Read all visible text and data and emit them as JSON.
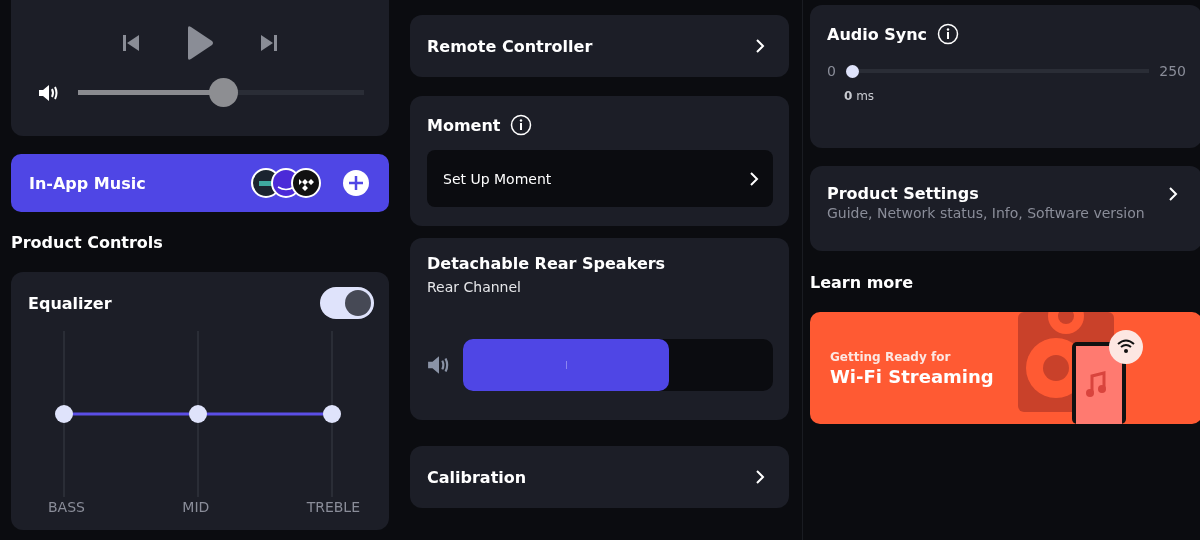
{
  "player": {
    "volume": {
      "level": 0.51
    }
  },
  "in_app_music": {
    "title": "In-App Music"
  },
  "product_controls": {
    "heading": "Product Controls"
  },
  "equalizer": {
    "title": "Equalizer",
    "on": true,
    "bands": [
      {
        "label": "BASS",
        "level": 0.5
      },
      {
        "label": "MID",
        "level": 0.5
      },
      {
        "label": "TREBLE",
        "level": 0.5
      }
    ]
  },
  "remote_controller": {
    "title": "Remote Controller"
  },
  "moment": {
    "title": "Moment",
    "action": "Set Up Moment"
  },
  "rear_speakers": {
    "title": "Detachable Rear Speakers",
    "subtitle": "Rear Channel",
    "level": 0.665
  },
  "calibration": {
    "title": "Calibration"
  },
  "audio_sync": {
    "title": "Audio Sync",
    "min": "0",
    "max": "250",
    "level": 0,
    "reading": "**0** ms"
  },
  "product_settings": {
    "title": "Product Settings",
    "subtitle": "Guide, Network status, Info, Software version"
  },
  "learn_more": {
    "heading": "Learn more",
    "banner": {
      "kicker": "Getting Ready for",
      "title": "Wi-Fi Streaming"
    }
  }
}
